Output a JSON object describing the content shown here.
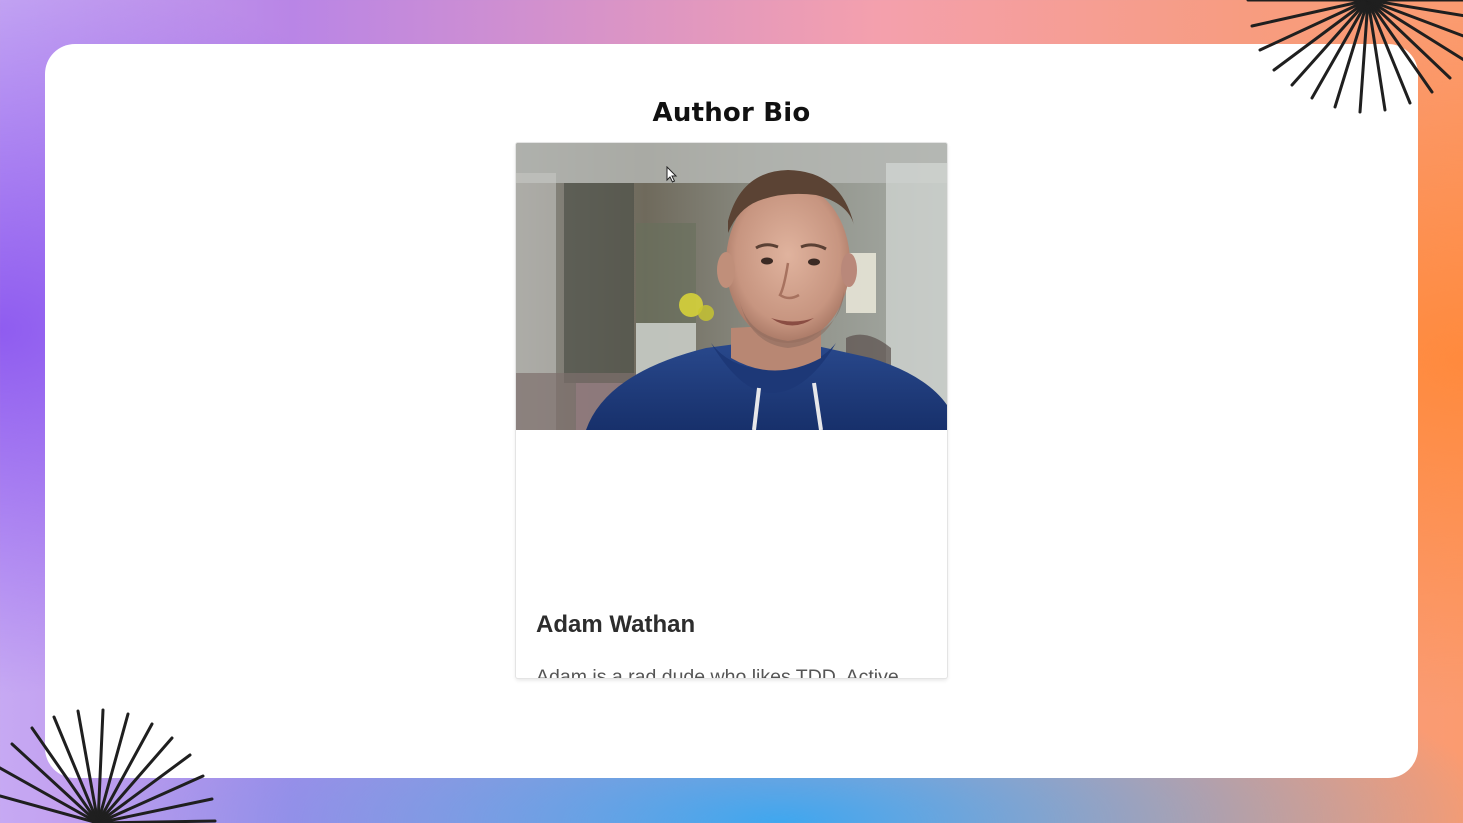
{
  "page": {
    "title": "Author Bio"
  },
  "card": {
    "name": "Adam Wathan",
    "bio": "Adam is a rad dude who likes TDD, Active Record, and garlic bread with cheese. He also hosts a decent podcast and has never had a really great haircut.",
    "photo_alt": "Adam Wathan photo"
  },
  "decorations": {
    "burst_icon_color": "#1f1f1f"
  },
  "colors": {
    "panel_background": "#ffffff",
    "title": "#111111",
    "name": "#2d2d2d",
    "bio": "#555555",
    "hoodie": "#1f3a78"
  }
}
